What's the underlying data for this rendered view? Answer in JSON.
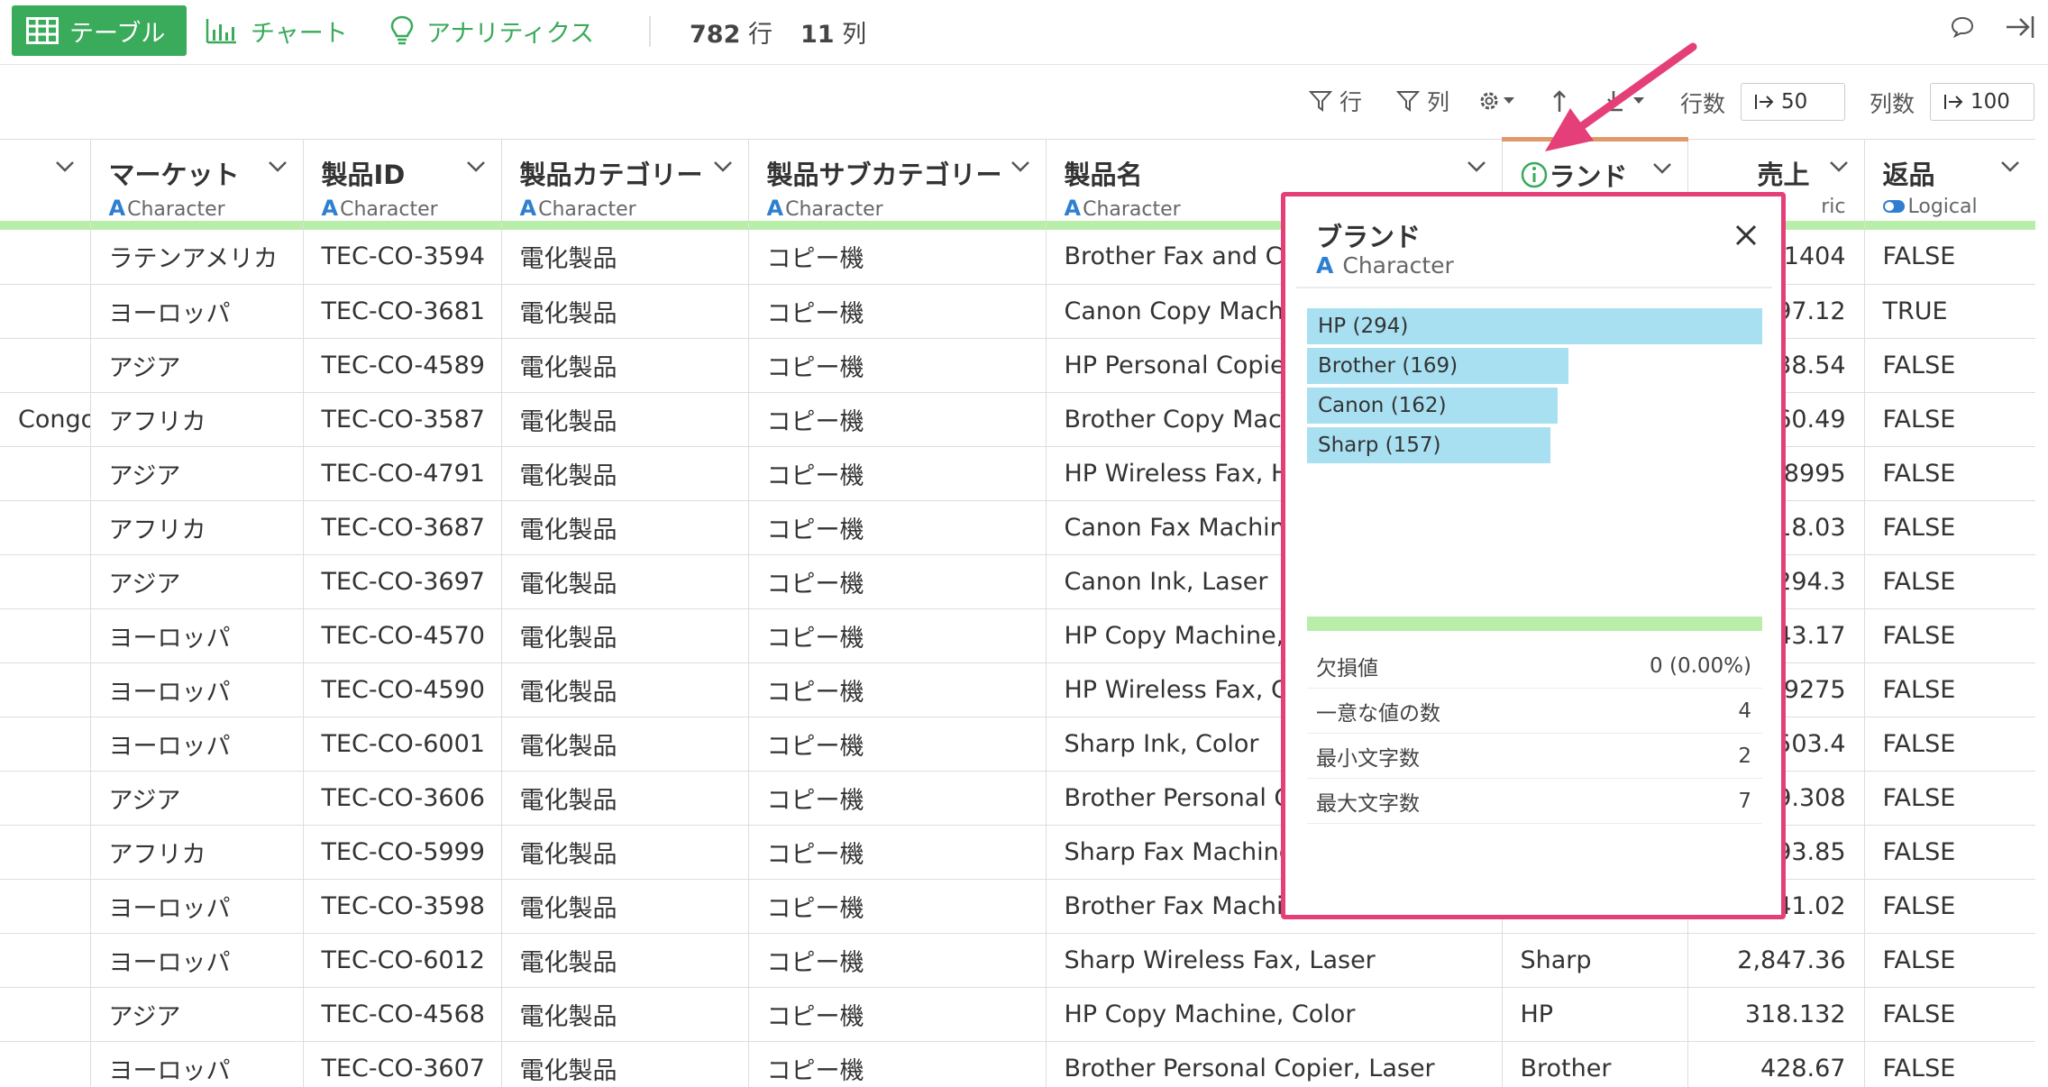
{
  "topbar": {
    "tab_table": "テーブル",
    "tab_chart": "チャート",
    "tab_analytics": "アナリティクス",
    "row_count": "782",
    "row_unit": "行",
    "col_count": "11",
    "col_unit": "列"
  },
  "toolbar": {
    "row_filter": "行",
    "col_filter": "列",
    "rows_label": "行数",
    "rows_value": "50",
    "cols_label": "列数",
    "cols_value": "100"
  },
  "columns": {
    "market": {
      "name": "マーケット",
      "type": "Character"
    },
    "product_id": {
      "name": "製品ID",
      "type": "Character"
    },
    "category": {
      "name": "製品カテゴリー",
      "type": "Character"
    },
    "subcategory": {
      "name": "製品サブカテゴリー",
      "type": "Character"
    },
    "product_name": {
      "name": "製品名",
      "type": "Character"
    },
    "brand": {
      "name": "ランド",
      "type": ""
    },
    "sales": {
      "name": "売上",
      "type": "ric"
    },
    "returned": {
      "name": "返品",
      "type": "Logical"
    }
  },
  "rows": [
    {
      "c0": "",
      "market": "ラテンアメリカ",
      "pid": "TEC-CO-3594",
      "cat": "電化製品",
      "sub": "コピー機",
      "name": "Brother Fax and Co",
      "brand": "",
      "sales": "1404",
      "ret": "FALSE"
    },
    {
      "c0": "",
      "market": "ヨーロッパ",
      "pid": "TEC-CO-3681",
      "cat": "電化製品",
      "sub": "コピー機",
      "name": "Canon Copy Machi",
      "brand": "",
      "sales": "97.12",
      "ret": "TRUE"
    },
    {
      "c0": "",
      "market": "アジア",
      "pid": "TEC-CO-4589",
      "cat": "電化製品",
      "sub": "コピー機",
      "name": "HP Personal Copie",
      "brand": "",
      "sales": "38.54",
      "ret": "FALSE"
    },
    {
      "c0": "Congo",
      "market": "アフリカ",
      "pid": "TEC-CO-3587",
      "cat": "電化製品",
      "sub": "コピー機",
      "name": "Brother Copy Mach",
      "brand": "",
      "sales": "60.49",
      "ret": "FALSE"
    },
    {
      "c0": "",
      "market": "アジア",
      "pid": "TEC-CO-4791",
      "cat": "電化製品",
      "sub": "コピー機",
      "name": "HP Wireless Fax, H",
      "brand": "",
      "sales": "8995",
      "ret": "FALSE"
    },
    {
      "c0": "",
      "market": "アフリカ",
      "pid": "TEC-CO-3687",
      "cat": "電化製品",
      "sub": "コピー機",
      "name": "Canon Fax Machin",
      "brand": "",
      "sales": "18.03",
      "ret": "FALSE"
    },
    {
      "c0": "",
      "market": "アジア",
      "pid": "TEC-CO-3697",
      "cat": "電化製品",
      "sub": "コピー機",
      "name": "Canon Ink, Laser",
      "brand": "",
      "sales": "294.3",
      "ret": "FALSE"
    },
    {
      "c0": "",
      "market": "ヨーロッパ",
      "pid": "TEC-CO-4570",
      "cat": "電化製品",
      "sub": "コピー機",
      "name": "HP Copy Machine,",
      "brand": "",
      "sales": "43.17",
      "ret": "FALSE"
    },
    {
      "c0": "",
      "market": "ヨーロッパ",
      "pid": "TEC-CO-4590",
      "cat": "電化製品",
      "sub": "コピー機",
      "name": "HP Wireless Fax, C",
      "brand": "",
      "sales": "9275",
      "ret": "FALSE"
    },
    {
      "c0": "",
      "market": "ヨーロッパ",
      "pid": "TEC-CO-6001",
      "cat": "電化製品",
      "sub": "コピー機",
      "name": "Sharp Ink, Color",
      "brand": "",
      "sales": "503.4",
      "ret": "FALSE"
    },
    {
      "c0": "",
      "market": "アジア",
      "pid": "TEC-CO-3606",
      "cat": "電化製品",
      "sub": "コピー機",
      "name": "Brother Personal C",
      "brand": "",
      "sales": "9.308",
      "ret": "FALSE"
    },
    {
      "c0": "",
      "market": "アフリカ",
      "pid": "TEC-CO-5999",
      "cat": "電化製品",
      "sub": "コピー機",
      "name": "Sharp Fax Machine",
      "brand": "",
      "sales": "93.85",
      "ret": "FALSE"
    },
    {
      "c0": "",
      "market": "ヨーロッパ",
      "pid": "TEC-CO-3598",
      "cat": "電化製品",
      "sub": "コピー機",
      "name": "Brother Fax Machi",
      "brand": "",
      "sales": "41.02",
      "ret": "FALSE"
    },
    {
      "c0": "",
      "market": "ヨーロッパ",
      "pid": "TEC-CO-6012",
      "cat": "電化製品",
      "sub": "コピー機",
      "name": "Sharp Wireless Fax, Laser",
      "brand": "Sharp",
      "sales": "2,847.36",
      "ret": "FALSE"
    },
    {
      "c0": "",
      "market": "アジア",
      "pid": "TEC-CO-4568",
      "cat": "電化製品",
      "sub": "コピー機",
      "name": "HP Copy Machine, Color",
      "brand": "HP",
      "sales": "318.132",
      "ret": "FALSE"
    },
    {
      "c0": "",
      "market": "ヨーロッパ",
      "pid": "TEC-CO-3607",
      "cat": "電化製品",
      "sub": "コピー機",
      "name": "Brother Personal Copier, Laser",
      "brand": "Brother",
      "sales": "428.67",
      "ret": "FALSE"
    }
  ],
  "popup": {
    "title": "ブランド",
    "type": "Character",
    "bars": [
      {
        "label": "HP (294)",
        "count": 294
      },
      {
        "label": "Brother (169)",
        "count": 169
      },
      {
        "label": "Canon (162)",
        "count": 162
      },
      {
        "label": "Sharp (157)",
        "count": 157
      }
    ],
    "stats": [
      {
        "label": "欠損値",
        "value": "0 (0.00%)"
      },
      {
        "label": "一意な値の数",
        "value": "4"
      },
      {
        "label": "最小文字数",
        "value": "2"
      },
      {
        "label": "最大文字数",
        "value": "7"
      }
    ]
  },
  "colors": {
    "accent_green": "#3aaa5b",
    "type_blue": "#2f7fd0",
    "highlight_pink": "#e43f78",
    "bar_blue": "#a8e0f2",
    "quality_green": "#b9eeaa"
  }
}
